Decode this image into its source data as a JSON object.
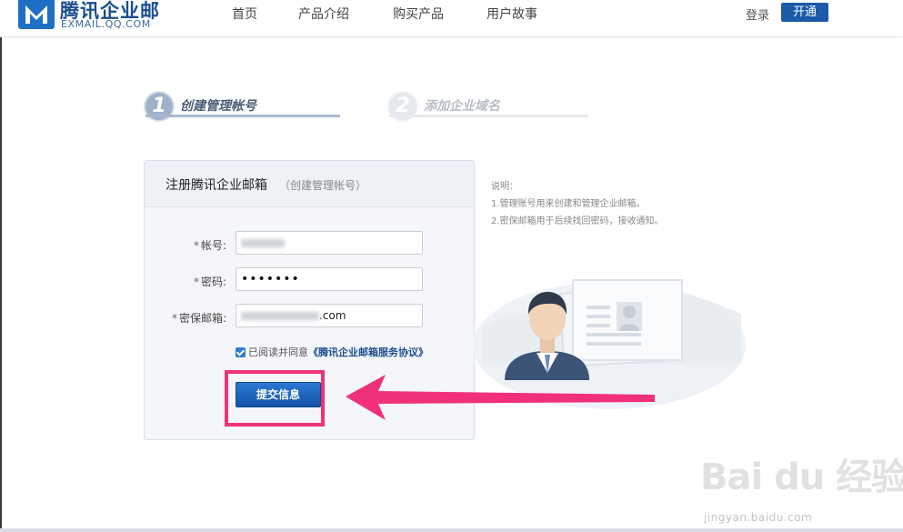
{
  "header": {
    "logo_cn": "腾讯企业邮",
    "logo_en": "EXMAIL.QQ.COM",
    "nav": [
      "首页",
      "产品介绍",
      "购买产品",
      "用户故事"
    ],
    "login_label": "登录",
    "open_label": "开通"
  },
  "steps": [
    {
      "number": "1",
      "label": "创建管理帐号",
      "active": true
    },
    {
      "number": "2",
      "label": "添加企业域名",
      "active": false
    }
  ],
  "form": {
    "title": "注册腾讯企业邮箱",
    "subtitle": "（创建管理帐号）",
    "account_label": "帐号:",
    "password_label": "密码:",
    "password_value": "•••••••",
    "email_label": "密保邮箱:",
    "email_value_suffix": ".com",
    "required_mark": "*",
    "agree_text": "已阅读并同意",
    "agree_link": "《腾讯企业邮箱服务协议》",
    "agree_checked": true,
    "submit_label": "提交信息"
  },
  "notes": {
    "title": "说明：",
    "items": [
      "1.管理账号用来创建和管理企业邮箱。",
      "2.密保邮箱用于后续找回密码，接收通知。"
    ]
  },
  "annotation": {
    "highlight_color": "#f0317a",
    "arrow_color": "#f0317a"
  },
  "watermark": {
    "brand": "Bai du 经验",
    "url": "jingyan.baidu.com"
  },
  "colors": {
    "brand_blue": "#1a5aa8",
    "submit_blue": "#1d62bb"
  }
}
